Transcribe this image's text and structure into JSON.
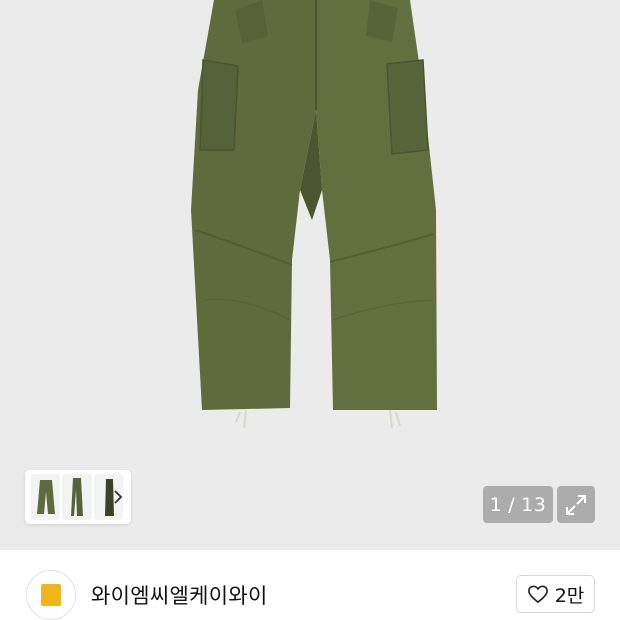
{
  "gallery": {
    "current_index": "1",
    "separator": "/",
    "total": "13",
    "thumbnail_count": 3
  },
  "seller": {
    "name": "와이엠씨엘케이와이"
  },
  "actions": {
    "like_count": "2만"
  },
  "colors": {
    "hero_background": "#ebebeb",
    "pants_olive": "#5f6b3d",
    "pants_shadow": "#4b5530",
    "avatar_badge": "#f1b51c"
  },
  "icons": {
    "thumbnail_next": "chevron-right-icon",
    "expand": "expand-arrows-icon",
    "like": "heart-outline-icon"
  }
}
